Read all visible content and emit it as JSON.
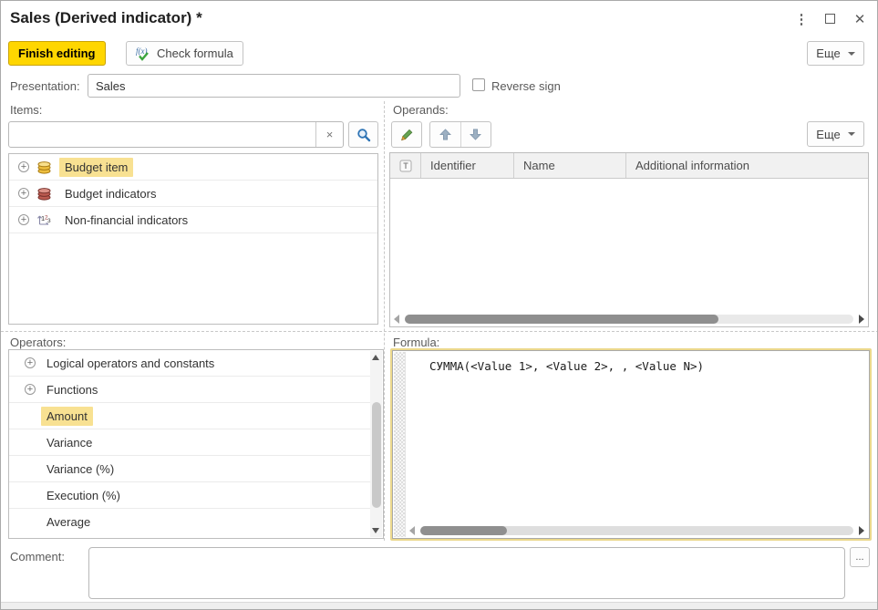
{
  "window": {
    "title": "Sales (Derived indicator) *"
  },
  "toolbar": {
    "finish_editing_label": "Finish editing",
    "check_formula_label": "Check formula",
    "more_label": "Еще"
  },
  "presentation": {
    "label": "Presentation:",
    "value": "Sales",
    "reverse_sign_label": "Reverse sign",
    "reverse_sign_checked": false
  },
  "items": {
    "label": "Items:",
    "search_value": "",
    "tree": [
      {
        "label": "Budget item",
        "icon": "coins-gold",
        "selected": true
      },
      {
        "label": "Budget indicators",
        "icon": "coins-red",
        "selected": false
      },
      {
        "label": "Non-financial indicators",
        "icon": "numeric-axis",
        "selected": false
      }
    ]
  },
  "operands": {
    "label": "Operands:",
    "more_label": "Еще",
    "columns": {
      "c1": "Identifier",
      "c2": "Name",
      "c3": "Additional information"
    },
    "rows": []
  },
  "operators": {
    "label": "Operators:",
    "tree": [
      {
        "label": "Logical operators and constants",
        "expandable": true,
        "selected": false
      },
      {
        "label": "Functions",
        "expandable": true,
        "selected": false
      },
      {
        "label": "Amount",
        "expandable": false,
        "selected": true
      },
      {
        "label": "Variance",
        "expandable": false,
        "selected": false
      },
      {
        "label": "Variance (%)",
        "expandable": false,
        "selected": false
      },
      {
        "label": "Execution (%)",
        "expandable": false,
        "selected": false
      },
      {
        "label": "Average",
        "expandable": false,
        "selected": false
      }
    ]
  },
  "formula": {
    "label": "Formula:",
    "value": "СУММА(<Value 1>, <Value 2>, , <Value N>)"
  },
  "comment": {
    "label": "Comment:",
    "value": "",
    "ellipsis_label": "..."
  },
  "icons": {
    "expand": "+",
    "clear": "×",
    "close": "✕",
    "menu": "⋮"
  },
  "colors": {
    "accent_yellow": "#ffd600",
    "selection_yellow": "#f8e192",
    "formula_focus_border": "#ebd88c"
  }
}
